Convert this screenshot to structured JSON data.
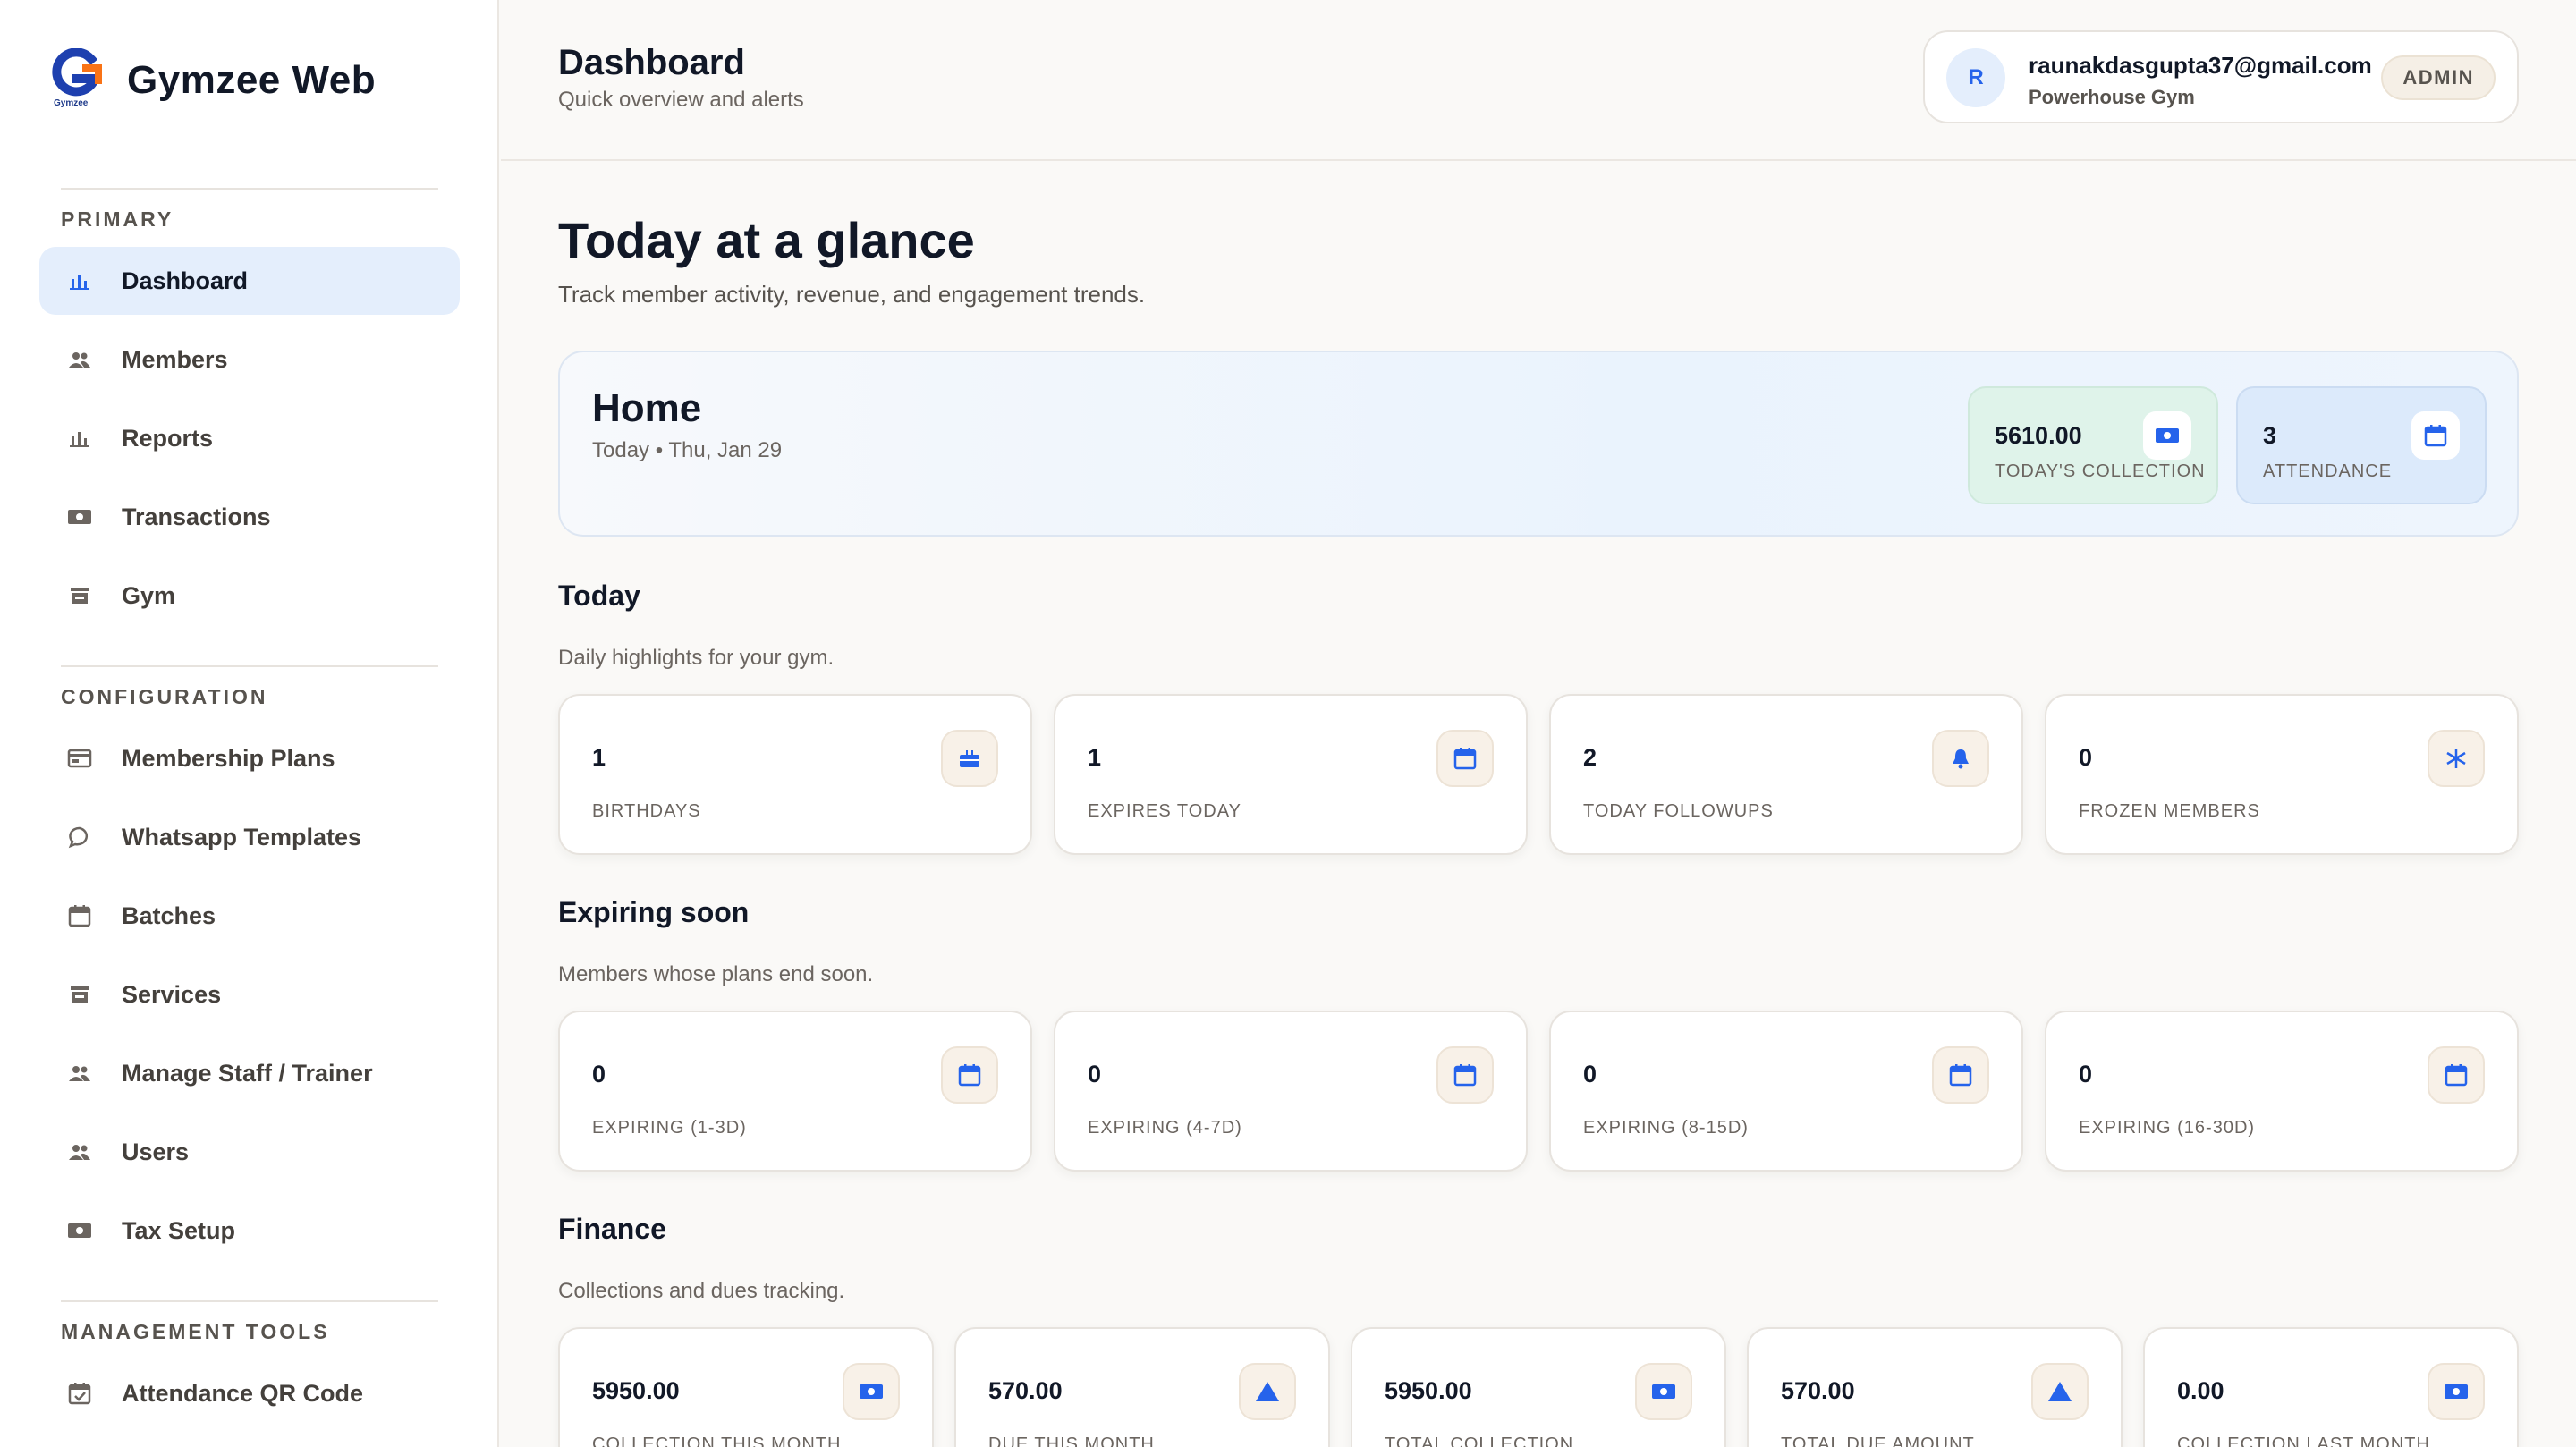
{
  "brand": {
    "name": "Gymzee Web",
    "logo_caption": "Gymzee"
  },
  "sidebar": {
    "sections": {
      "primary": "PRIMARY",
      "configuration": "CONFIGURATION",
      "management": "MANAGEMENT TOOLS"
    },
    "items": [
      {
        "label": "Dashboard",
        "icon": "bar-chart-icon",
        "active": true
      },
      {
        "label": "Members",
        "icon": "people-icon"
      },
      {
        "label": "Reports",
        "icon": "bar-chart-icon"
      },
      {
        "label": "Transactions",
        "icon": "cash-icon"
      },
      {
        "label": "Gym",
        "icon": "store-icon"
      },
      {
        "label": "Membership Plans",
        "icon": "card-icon"
      },
      {
        "label": "Whatsapp Templates",
        "icon": "chat-icon"
      },
      {
        "label": "Batches",
        "icon": "calendar-icon"
      },
      {
        "label": "Services",
        "icon": "store-icon"
      },
      {
        "label": "Manage Staff / Trainer",
        "icon": "people-icon"
      },
      {
        "label": "Users",
        "icon": "people-icon"
      },
      {
        "label": "Tax Setup",
        "icon": "cash-icon"
      },
      {
        "label": "Attendance QR Code",
        "icon": "calendar-check-icon"
      }
    ]
  },
  "header": {
    "title": "Dashboard",
    "subtitle": "Quick overview and alerts",
    "user": {
      "avatar_initial": "R",
      "email": "raunakdasgupta37@gmail.com",
      "gym": "Powerhouse Gym",
      "role": "ADMIN"
    }
  },
  "main": {
    "title": "Today at a glance",
    "subtitle": "Track member activity, revenue, and engagement trends.",
    "home": {
      "title": "Home",
      "date": "Today • Thu, Jan 29",
      "collection": {
        "value": "5610.00",
        "label": "TODAY'S COLLECTION",
        "icon": "cash-icon"
      },
      "attendance": {
        "value": "3",
        "label": "ATTENDANCE",
        "icon": "calendar-icon"
      }
    },
    "today": {
      "title": "Today",
      "subtitle": "Daily highlights for your gym.",
      "cards": [
        {
          "value": "1",
          "label": "BIRTHDAYS",
          "icon": "cake-icon"
        },
        {
          "value": "1",
          "label": "EXPIRES TODAY",
          "icon": "calendar-icon"
        },
        {
          "value": "2",
          "label": "TODAY FOLLOWUPS",
          "icon": "bell-icon"
        },
        {
          "value": "0",
          "label": "FROZEN MEMBERS",
          "icon": "snowflake-icon"
        }
      ]
    },
    "expiring": {
      "title": "Expiring soon",
      "subtitle": "Members whose plans end soon.",
      "cards": [
        {
          "value": "0",
          "label": "EXPIRING (1-3D)",
          "icon": "calendar-icon"
        },
        {
          "value": "0",
          "label": "EXPIRING (4-7D)",
          "icon": "calendar-icon"
        },
        {
          "value": "0",
          "label": "EXPIRING (8-15D)",
          "icon": "calendar-icon"
        },
        {
          "value": "0",
          "label": "EXPIRING (16-30D)",
          "icon": "calendar-icon"
        }
      ]
    },
    "finance": {
      "title": "Finance",
      "subtitle": "Collections and dues tracking.",
      "cards": [
        {
          "value": "5950.00",
          "label": "COLLECTION THIS MONTH",
          "icon": "cash-icon"
        },
        {
          "value": "570.00",
          "label": "DUE THIS MONTH",
          "icon": "warning-triangle-icon"
        },
        {
          "value": "5950.00",
          "label": "TOTAL COLLECTION",
          "icon": "cash-icon"
        },
        {
          "value": "570.00",
          "label": "TOTAL DUE AMOUNT",
          "icon": "warning-triangle-icon"
        },
        {
          "value": "0.00",
          "label": "COLLECTION LAST MONTH",
          "icon": "cash-icon"
        }
      ]
    }
  },
  "colors": {
    "accent": "#2563eb",
    "nav_icon": "#6b6560",
    "active_bg": "#e4eefc"
  }
}
